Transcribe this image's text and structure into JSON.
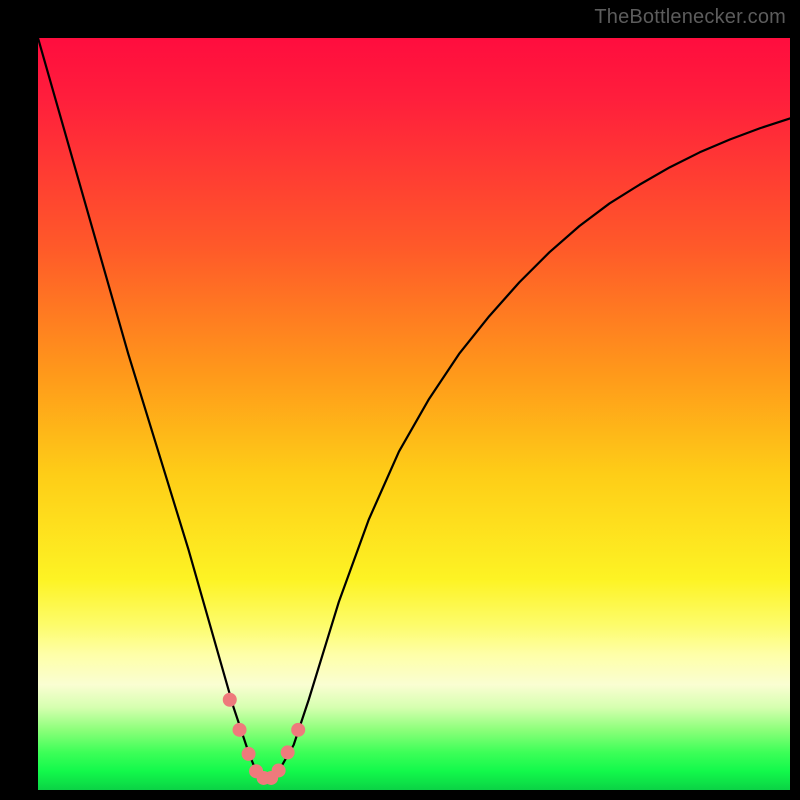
{
  "watermark": "TheBottlenecker.com",
  "chart_data": {
    "type": "line",
    "title": "",
    "xlabel": "",
    "ylabel": "",
    "xlim": [
      0,
      100
    ],
    "ylim": [
      0,
      100
    ],
    "curve": {
      "name": "bottleneck-curve",
      "x": [
        0,
        4,
        8,
        12,
        16,
        20,
        24,
        26,
        28,
        29,
        30,
        31,
        32,
        34,
        36,
        40,
        44,
        48,
        52,
        56,
        60,
        64,
        68,
        72,
        76,
        80,
        84,
        88,
        92,
        96,
        100
      ],
      "y": [
        100,
        86,
        72,
        58,
        45,
        32,
        18,
        11,
        5,
        2.5,
        1.5,
        1.5,
        2.5,
        6,
        12,
        25,
        36,
        45,
        52,
        58,
        63,
        67.5,
        71.5,
        75,
        78,
        80.5,
        82.8,
        84.8,
        86.5,
        88,
        89.3
      ]
    },
    "highlight_points": {
      "name": "curve-dots",
      "x": [
        25.5,
        26.8,
        28.0,
        29.0,
        30.0,
        31.0,
        32.0,
        33.2,
        34.6
      ],
      "y": [
        12.0,
        8.0,
        4.8,
        2.5,
        1.6,
        1.6,
        2.6,
        5.0,
        8.0
      ]
    },
    "colors": {
      "curve": "#000000",
      "dots": "#ee7a7c",
      "gradient_top": "#ff0d3e",
      "gradient_mid1": "#ff9a1a",
      "gradient_mid2": "#fdf324",
      "gradient_bottom": "#0bd245"
    }
  }
}
